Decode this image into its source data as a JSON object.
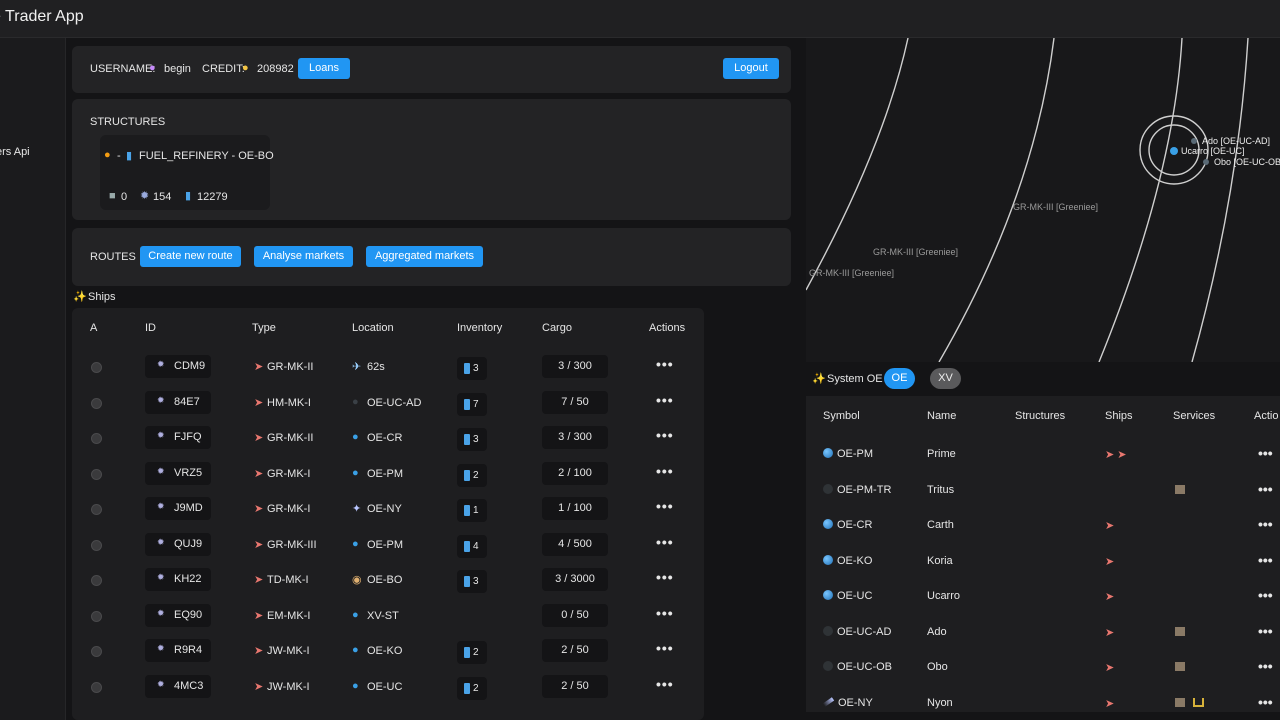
{
  "app": {
    "title": "e Trader App"
  },
  "sidebar": {
    "items": [
      {
        "label": "ers Api"
      },
      {
        "label": "!"
      }
    ]
  },
  "user": {
    "username_label": "USERNAME:",
    "username": "begin",
    "credit_label": "CREDIT:",
    "credit": "208982",
    "loans_label": "Loans",
    "logout_label": "Logout"
  },
  "structures": {
    "title": "STRUCTURES",
    "card": {
      "name": "FUEL_REFINERY - OE-BO",
      "prefix": "-",
      "stats": {
        "robots": "0",
        "parts": "154",
        "fuel": "12279"
      }
    }
  },
  "routes": {
    "title": "ROUTES",
    "buttons": [
      "Create new route",
      "Analyse markets",
      "Aggregated markets"
    ]
  },
  "ships": {
    "title": "Ships",
    "columns": [
      "A",
      "ID",
      "Type",
      "Location",
      "Inventory",
      "Cargo",
      "Actions"
    ],
    "rows": [
      {
        "id": "CDM9",
        "type": "GR-MK-II",
        "location": "62s",
        "loc_icon": "plane-icon",
        "inventory": "3",
        "cargo": "3 / 300"
      },
      {
        "id": "84E7",
        "type": "HM-MK-I",
        "location": "OE-UC-AD",
        "loc_icon": "moon-icon",
        "inventory": "7",
        "cargo": "7 / 50"
      },
      {
        "id": "FJFQ",
        "type": "GR-MK-II",
        "location": "OE-CR",
        "loc_icon": "globe-icon",
        "inventory": "3",
        "cargo": "3 / 300"
      },
      {
        "id": "VRZ5",
        "type": "GR-MK-I",
        "location": "OE-PM",
        "loc_icon": "globe-icon",
        "inventory": "2",
        "cargo": "2 / 100"
      },
      {
        "id": "J9MD",
        "type": "GR-MK-I",
        "location": "OE-NY",
        "loc_icon": "comet-icon",
        "inventory": "1",
        "cargo": "1 / 100"
      },
      {
        "id": "QUJ9",
        "type": "GR-MK-III",
        "location": "OE-PM",
        "loc_icon": "globe-icon",
        "inventory": "4",
        "cargo": "4 / 500"
      },
      {
        "id": "KH22",
        "type": "TD-MK-I",
        "location": "OE-BO",
        "loc_icon": "saturn-icon",
        "inventory": "3",
        "cargo": "3 / 3000"
      },
      {
        "id": "EQ90",
        "type": "EM-MK-I",
        "location": "XV-ST",
        "loc_icon": "globe-icon",
        "inventory": "",
        "cargo": "0 / 50"
      },
      {
        "id": "R9R4",
        "type": "JW-MK-I",
        "location": "OE-KO",
        "loc_icon": "globe-icon",
        "inventory": "2",
        "cargo": "2 / 50"
      },
      {
        "id": "4MC3",
        "type": "JW-MK-I",
        "location": "OE-UC",
        "loc_icon": "globe-icon",
        "inventory": "2",
        "cargo": "2 / 50"
      }
    ],
    "actions_label": "•••"
  },
  "map": {
    "labels": [
      {
        "text": "Ado [OE-UC-AD]"
      },
      {
        "text": "Ucarro [OE-UC]"
      },
      {
        "text": "Obo [OE-UC-OB]"
      },
      {
        "text": "GR-MK-III [Greeniee]"
      },
      {
        "text": "GR-MK-III [Greeniee]"
      },
      {
        "text": "GR-MK-III [Greeniee]"
      }
    ]
  },
  "system": {
    "title": "System OE",
    "pills": [
      "OE",
      "XV"
    ],
    "columns": [
      "Symbol",
      "Name",
      "Structures",
      "Ships",
      "Services",
      "Actio"
    ],
    "rows": [
      {
        "symbol": "OE-PM",
        "name": "Prime",
        "icon": "globe-icon",
        "ships": 2,
        "services": ""
      },
      {
        "symbol": "OE-PM-TR",
        "name": "Tritus",
        "icon": "moon-icon",
        "ships": 0,
        "services": "building"
      },
      {
        "symbol": "OE-CR",
        "name": "Carth",
        "icon": "globe-icon",
        "ships": 1,
        "services": ""
      },
      {
        "symbol": "OE-KO",
        "name": "Koria",
        "icon": "globe-icon",
        "ships": 1,
        "services": ""
      },
      {
        "symbol": "OE-UC",
        "name": "Ucarro",
        "icon": "globe-icon",
        "ships": 1,
        "services": ""
      },
      {
        "symbol": "OE-UC-AD",
        "name": "Ado",
        "icon": "moon-icon",
        "ships": 1,
        "services": "building"
      },
      {
        "symbol": "OE-UC-OB",
        "name": "Obo",
        "icon": "moon-icon",
        "ships": 1,
        "services": "building"
      },
      {
        "symbol": "OE-NY",
        "name": "Nyon",
        "icon": "comet-icon",
        "ships": 1,
        "services": "building-shipyard"
      }
    ],
    "actions_label": "•••"
  },
  "colors": {
    "accent": "#2196f3",
    "background": "#141416",
    "panel": "#232325"
  }
}
